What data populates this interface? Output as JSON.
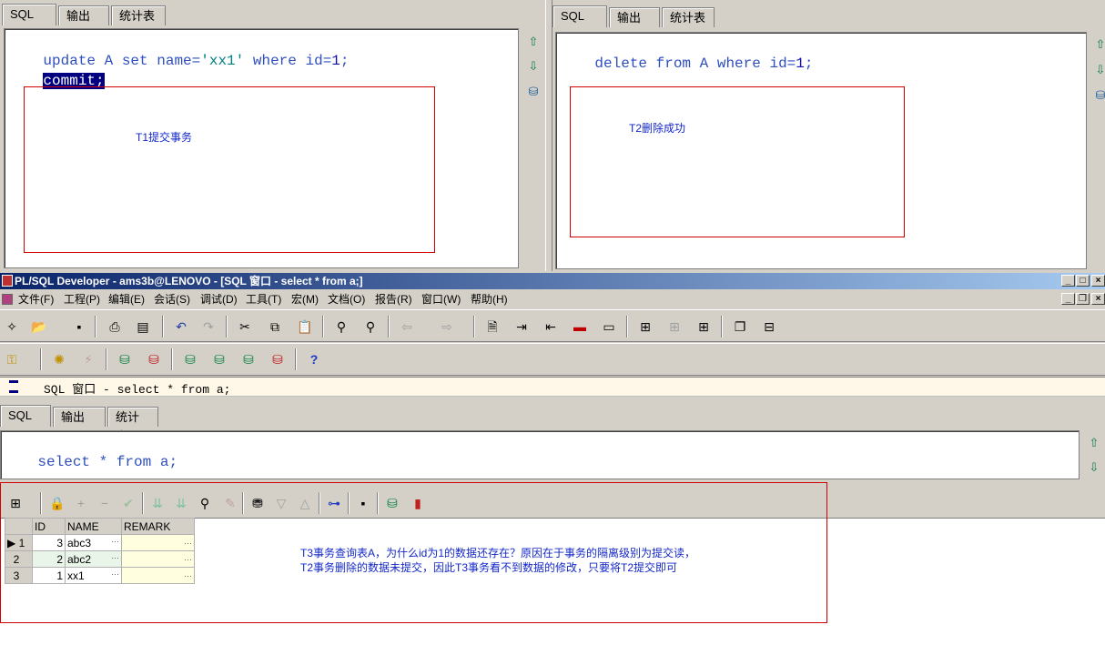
{
  "left_pane": {
    "tabs": [
      "SQL",
      "输出",
      "统计表"
    ],
    "code": {
      "line1": {
        "kw1": "update",
        "t1": " A ",
        "kw2": "set",
        "t2": " name=",
        "str": "'xx1'",
        "t3": " ",
        "kw3": "where",
        "t4": " id=",
        "num": "1",
        "t5": ";"
      },
      "line2": "commit;"
    },
    "note": "T1提交事务"
  },
  "right_pane": {
    "tabs": [
      "SQL",
      "输出",
      "统计表"
    ],
    "code": {
      "kw1": "delete",
      "t1": " ",
      "kw2": "from",
      "t2": " A ",
      "kw3": "where",
      "t3": " id=",
      "num": "1",
      "t4": ";"
    },
    "note": "T2删除成功"
  },
  "app": {
    "title": "PL/SQL Developer - ams3b@LENOVO - [SQL 窗口 - select * from a;]",
    "menu": [
      "文件(F)",
      "工程(P)",
      "编辑(E)",
      "会话(S)",
      "调试(D)",
      "工具(T)",
      "宏(M)",
      "文档(O)",
      "报告(R)",
      "窗口(W)",
      "帮助(H)"
    ],
    "window_caption": "SQL 窗口 - select * from a;",
    "tabs": [
      "SQL",
      "输出",
      "统计表"
    ],
    "query": {
      "kw1": "select",
      "t1": " * ",
      "kw2": "from",
      "t2": " a;"
    },
    "grid": {
      "columns": [
        "",
        "ID",
        "NAME",
        "REMARK"
      ],
      "rows": [
        {
          "n": "1",
          "id": "3",
          "name": "abc3",
          "remark": ""
        },
        {
          "n": "2",
          "id": "2",
          "name": "abc2",
          "remark": ""
        },
        {
          "n": "3",
          "id": "1",
          "name": "xx1",
          "remark": ""
        }
      ],
      "cell_btn": "···"
    },
    "note": "T3事务查询表A，为什么id为1的数据还存在？原因在于事务的隔离级别为提交读，\nT2事务删除的数据未提交，因此T3事务看不到数据的修改，只要将T2提交即可"
  },
  "colors": {
    "keyword": "#2f4fbf",
    "string": "#008080",
    "number": "#1010b0",
    "annotation": "#1428c8",
    "annotation_box": "#d00000",
    "selection": "#000080"
  },
  "icons": {
    "side": [
      "arrow-up-icon",
      "arrow-down-icon",
      "database-icon"
    ],
    "toolbar1": [
      "new-icon",
      "open-icon",
      "save-icon",
      "print-icon",
      "print-preview-icon",
      "undo-icon",
      "redo-icon",
      "cut-icon",
      "copy-icon",
      "paste-icon",
      "find-icon",
      "find-next-icon",
      "back-icon",
      "forward-icon",
      "file-icon",
      "indent-icon",
      "unindent-icon",
      "uppercase-icon",
      "lowercase-icon",
      "comment-icon",
      "uncomment-icon",
      "explain-icon",
      "window-list-icon",
      "tile-icon"
    ],
    "toolbar2": [
      "key-icon",
      "execute-icon",
      "break-icon",
      "commit-icon",
      "rollback-icon",
      "session-icon",
      "sql-icon",
      "connect-icon",
      "disconnect-icon",
      "help-icon"
    ]
  }
}
